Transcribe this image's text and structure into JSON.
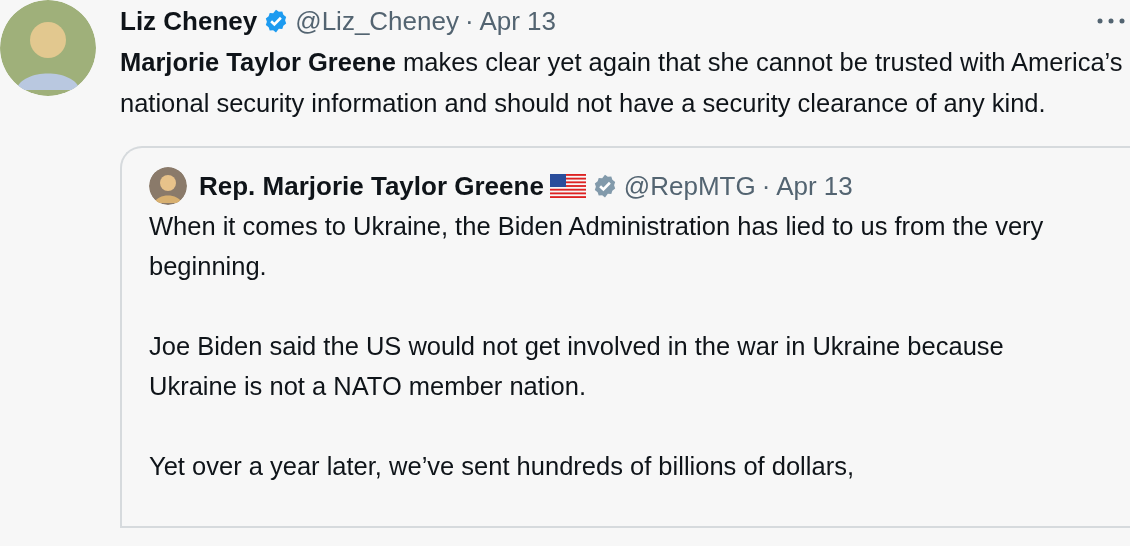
{
  "tweet": {
    "author": {
      "name": "Liz Cheney",
      "verified": true,
      "handle": "@Liz_Cheney",
      "date": "· Apr 13"
    },
    "text": "**Marjorie Taylor Greene** makes clear yet again that she cannot be trusted with America’s national security information and should not have a security clearance of any kind.",
    "quote": {
      "author": {
        "name": "Rep. Marjorie Taylor Greene",
        "verified": true,
        "handle": "@RepMTG",
        "date": "· Apr 13"
      },
      "paragraphs": [
        "When it comes to Ukraine, the Biden Administration has lied to us from the very beginning.",
        "Joe Biden said the US would not get involved in the war in Ukraine because Ukraine is not a NATO member nation.",
        "Yet over a year later, we’ve sent hundreds of billions of dollars,"
      ]
    }
  }
}
